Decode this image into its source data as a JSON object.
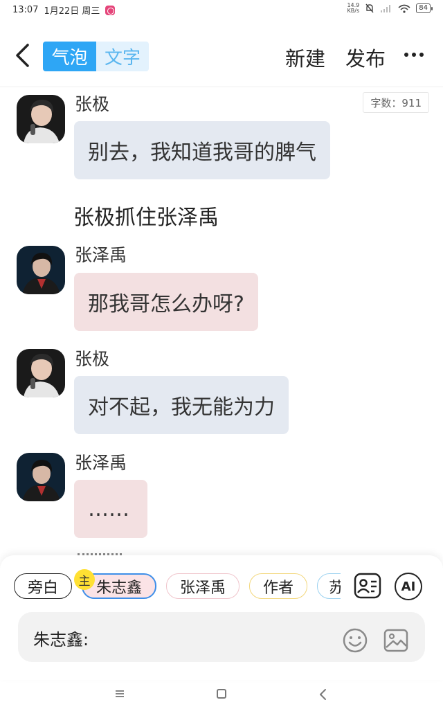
{
  "status": {
    "time": "13:07",
    "date": "1月22日 周三",
    "net_speed_value": "14.9",
    "net_speed_unit": "KB/s",
    "battery": "84"
  },
  "header": {
    "seg_bubble": "气泡",
    "seg_text": "文字",
    "new_label": "新建",
    "publish_label": "发布"
  },
  "chat": {
    "word_count": "字数：911",
    "messages": [
      {
        "sender": "张极",
        "text": "别去，我知道我哥的脾气"
      },
      {
        "narration": "张极抓住张泽禹"
      },
      {
        "sender": "张泽禹",
        "text": "那我哥怎么办呀?"
      },
      {
        "sender": "张极",
        "text": "对不起，我无能为力"
      },
      {
        "sender": "张泽禹",
        "text": "……"
      }
    ]
  },
  "roles": {
    "main_badge": "主",
    "chips": [
      "旁白",
      "朱志鑫",
      "张泽禹",
      "作者",
      "苏"
    ],
    "ai_label": "AI"
  },
  "input": {
    "prefix": "朱志鑫:"
  },
  "colors": {
    "accent": "#2ea6f5",
    "bubble_blue": "#e4e9f1",
    "bubble_pink": "#f3e0e1",
    "badge_yellow": "#ffe033"
  }
}
